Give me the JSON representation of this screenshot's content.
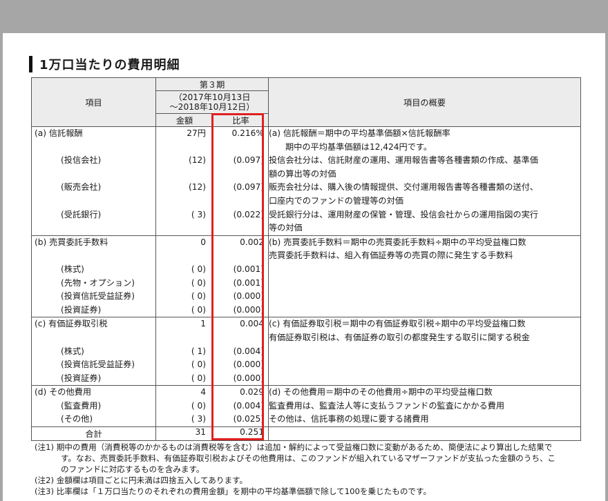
{
  "heading": "1万口当たりの費用明細",
  "header": {
    "item_col": "項目",
    "period": "第３期",
    "period_range_1": "（2017年10月13日",
    "period_range_2": "～2018年10月12日）",
    "amount_col": "金額",
    "ratio_col": "比率",
    "overview_col": "項目の概要"
  },
  "sections": [
    {
      "items": [
        "(a) 信託報酬",
        "(投信会社)",
        "(販売会社)",
        "(受託銀行)"
      ],
      "amounts": [
        "27円",
        "(12)",
        "(12)",
        "( 3)"
      ],
      "ratios": [
        "0.216%",
        "(0.097)",
        "(0.097)",
        "(0.022)"
      ],
      "overview": [
        "(a) 信託報酬＝期中の平均基準価額×信託報酬率",
        "期中の平均基準価額は12,424円です。",
        "投信会社分は、信託財産の運用、運用報告書等各種書類の作成、基準価",
        "額の算出等の対価",
        "販売会社分は、購入後の情報提供、交付運用報告書等各種書類の送付、",
        "口座内でのファンドの管理等の対価",
        "受託銀行分は、運用財産の保管・管理、投信会社からの運用指図の実行",
        "等の対価"
      ]
    },
    {
      "items": [
        "(b) 売買委託手数料",
        "(株式)",
        "(先物・オプション)",
        "(投資信託受益証券)",
        "(投資証券)"
      ],
      "amounts": [
        "0",
        "( 0)",
        "( 0)",
        "( 0)",
        "( 0)"
      ],
      "ratios": [
        "0.002",
        "(0.001)",
        "(0.001)",
        "(0.000)",
        "(0.000)"
      ],
      "overview": [
        "(b) 売買委託手数料＝期中の売買委託手数料÷期中の平均受益権口数",
        "売買委託手数料は、組入有価証券等の売買の際に発生する手数料"
      ]
    },
    {
      "items": [
        "(c) 有価証券取引税",
        "(株式)",
        "(投資信託受益証券)",
        "(投資証券)"
      ],
      "amounts": [
        "1",
        "( 1)",
        "( 0)",
        "( 0)"
      ],
      "ratios": [
        "0.004",
        "(0.004)",
        "(0.000)",
        "(0.000)"
      ],
      "overview": [
        "(c) 有価証券取引税＝期中の有価証券取引税÷期中の平均受益権口数",
        "有価証券取引税は、有価証券の取引の都度発生する取引に関する税金"
      ]
    },
    {
      "items": [
        "(d) その他費用",
        "(監査費用)",
        "(その他)"
      ],
      "amounts": [
        "4",
        "( 0)",
        "( 3)"
      ],
      "ratios": [
        "0.029",
        "(0.004)",
        "(0.025)"
      ],
      "overview": [
        "(d) その他費用＝期中のその他費用÷期中の平均受益権口数",
        "監査費用は、監査法人等に支払うファンドの監査にかかる費用",
        "その他は、信託事務の処理に要する諸費用"
      ]
    }
  ],
  "total": {
    "label": "合計",
    "amount": "31",
    "ratio": "0.251"
  },
  "notes": {
    "n1_1": "(注1) 期中の費用（消費税等のかかるものは消費税等を含む）は追加・解約によって受益権口数に変動があるため、簡便法により算出した結果で",
    "n1_2": "す。なお、売買委託手数料、有価証券取引税およびその他費用は、このファンドが組入れているマザーファンドが支払った金額のうち、こ",
    "n1_3": "のファンドに対応するものを含みます。",
    "n2": "(注2) 金額欄は項目ごとに円未満は四捨五入してあります。",
    "n3": "(注3) 比率欄は「１万口当たりのそれぞれの費用金額」を期中の平均基準価額で除して100を乗じたものです。"
  },
  "colors": {
    "highlight": "#e02020",
    "header_bg": "#ececec",
    "frame": "#a6a6a6"
  }
}
